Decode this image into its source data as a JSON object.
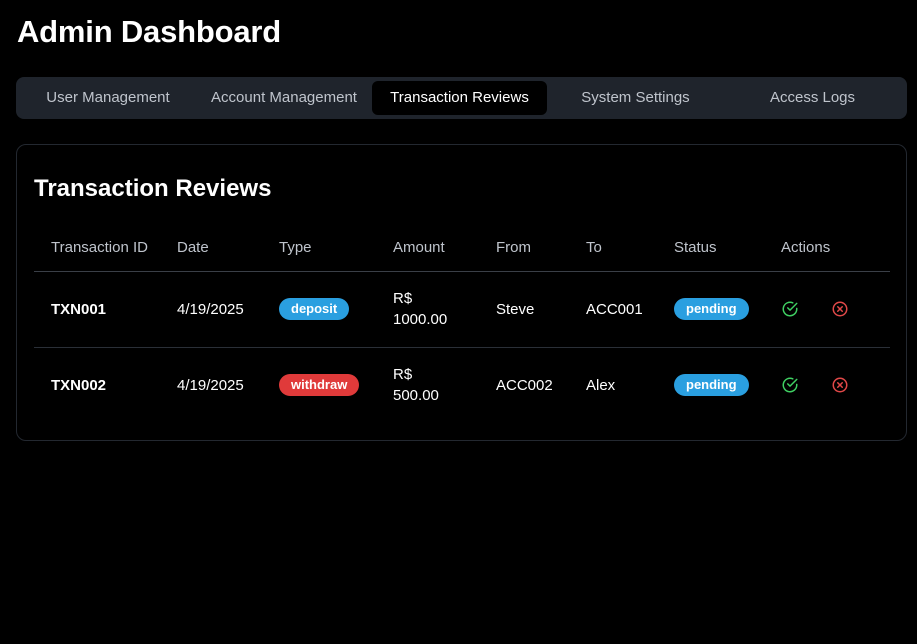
{
  "header": {
    "title": "Admin Dashboard"
  },
  "tabs": [
    {
      "label": "User Management",
      "active": false
    },
    {
      "label": "Account Management",
      "active": false
    },
    {
      "label": "Transaction Reviews",
      "active": true
    },
    {
      "label": "System Settings",
      "active": false
    },
    {
      "label": "Access Logs",
      "active": false
    }
  ],
  "panel": {
    "title": "Transaction Reviews",
    "columns": [
      "Transaction ID",
      "Date",
      "Type",
      "Amount",
      "From",
      "To",
      "Status",
      "Actions"
    ],
    "rows": [
      {
        "id": "TXN001",
        "date": "4/19/2025",
        "type": "deposit",
        "amount_currency": "R$",
        "amount_value": "1000.00",
        "from": "Steve",
        "to": "ACC001",
        "status": "pending"
      },
      {
        "id": "TXN002",
        "date": "4/19/2025",
        "type": "withdraw",
        "amount_currency": "R$",
        "amount_value": "500.00",
        "from": "ACC002",
        "to": "Alex",
        "status": "pending"
      }
    ]
  },
  "colors": {
    "deposit": "#2a9fe0",
    "withdraw": "#e03a3a",
    "pending": "#2a9fe0",
    "approve_icon": "#3fcf62",
    "reject_icon": "#e04848"
  },
  "icons": {
    "approve": "check-circle-icon",
    "reject": "x-circle-icon"
  }
}
